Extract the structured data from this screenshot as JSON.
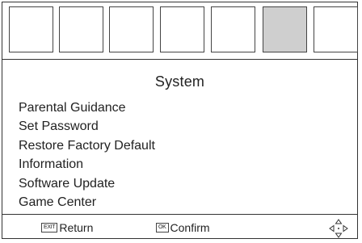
{
  "tabs": {
    "count": 7,
    "selected_index": 5
  },
  "page_title": "System",
  "menu_items": [
    "Parental Guidance",
    "Set Password",
    "Restore Factory Default",
    "Information",
    "Software Update",
    "Game Center"
  ],
  "footer": {
    "return_key": "EXIT",
    "return_label": "Return",
    "confirm_key": "OK",
    "confirm_label": "Confirm",
    "nav_icon": "dpad-arrows-icon"
  },
  "colors": {
    "selected_tab": "#cfcfcf",
    "border": "#333333",
    "text": "#222222"
  }
}
